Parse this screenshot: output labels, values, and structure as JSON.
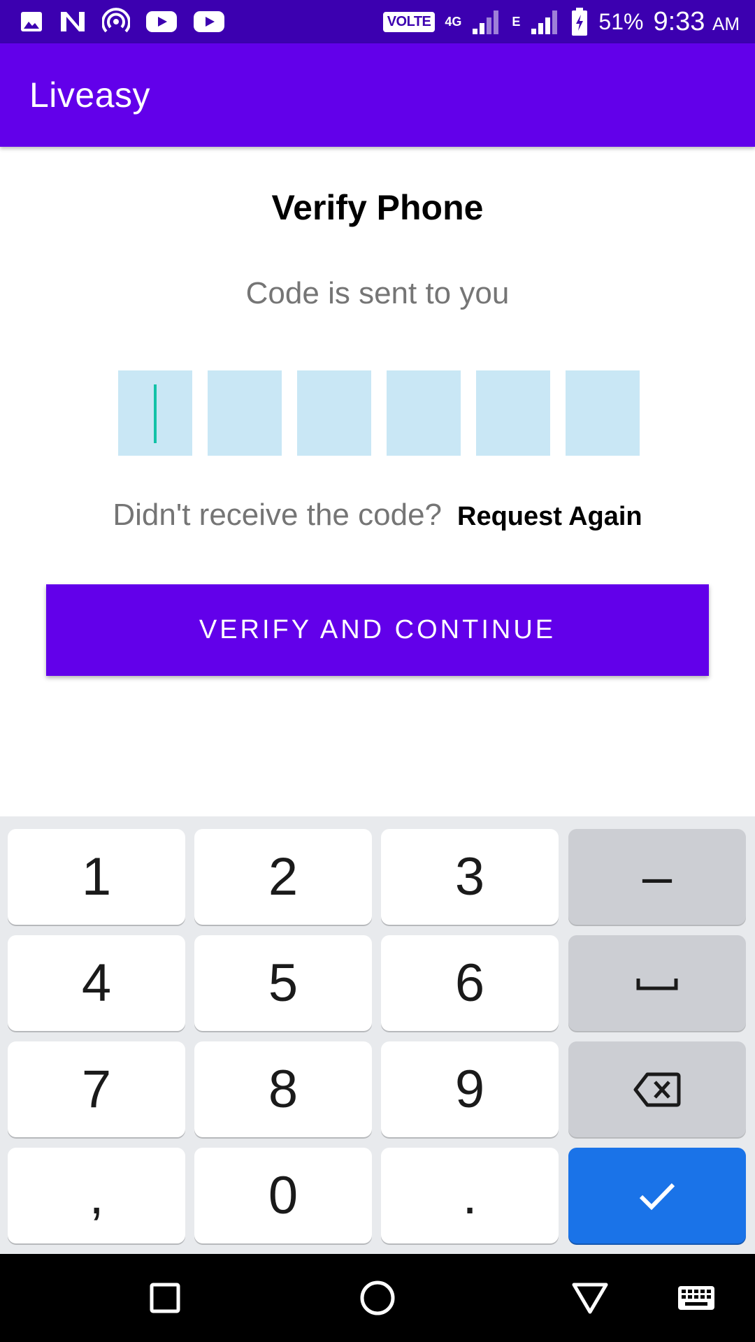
{
  "status_bar": {
    "volte": "VOLTE",
    "network_4g": "4G",
    "network_e": "E",
    "battery_percent": "51%",
    "time": "9:33",
    "time_suffix": "AM",
    "icons": [
      "gallery-icon",
      "n-app-icon",
      "hotspot-icon",
      "youtube-icon",
      "youtube-icon",
      "signal-icon",
      "signal-icon",
      "battery-charging-icon"
    ]
  },
  "app_bar": {
    "title": "Liveasy"
  },
  "verify": {
    "title": "Verify Phone",
    "subtitle": "Code is sent to you",
    "otp_digits": [
      "",
      "",
      "",
      "",
      "",
      ""
    ],
    "resend_prompt": "Didn't receive the code?",
    "resend_link": "Request Again",
    "button_label": "VERIFY AND CONTINUE"
  },
  "keyboard": {
    "keys": [
      "1",
      "2",
      "3",
      "–",
      "4",
      "5",
      "6",
      "7",
      "8",
      "9",
      ",",
      "0",
      "."
    ],
    "icons": [
      "space-icon",
      "backspace-icon",
      "checkmark-icon"
    ]
  },
  "nav_bar": {
    "icons": [
      "recents-icon",
      "home-icon",
      "back-icon",
      "keyboard-icon"
    ]
  },
  "colors": {
    "status_bar": "#3c00b0",
    "primary": "#6200ea",
    "otp_box": "#c9e7f5",
    "caret": "#13c2a8",
    "key_ok": "#1a73e8"
  }
}
